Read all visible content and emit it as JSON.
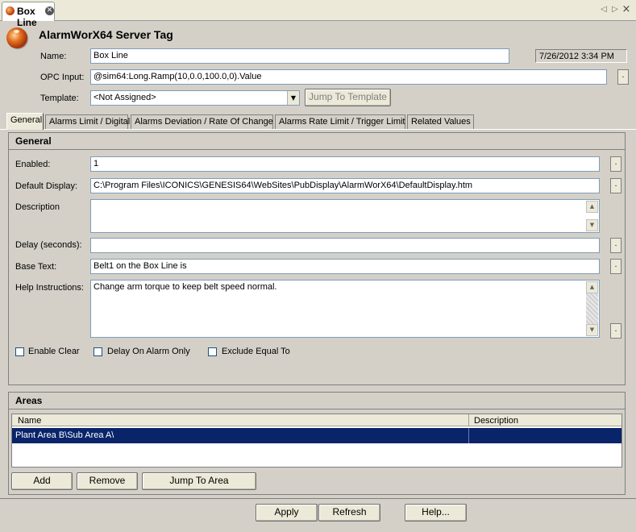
{
  "doc_tab": {
    "label": "Box Line",
    "close_glyph": "✕"
  },
  "nav": {
    "left": "◁",
    "right": "▷",
    "close": "×"
  },
  "header": {
    "title": "AlarmWorX64 Server Tag",
    "name_label": "Name:",
    "name_value": "Box Line",
    "timestamp": "7/26/2012 3:34 PM",
    "opc_label": "OPC Input:",
    "opc_value": "@sim64:Long.Ramp(10,0.0,100.0,0).Value",
    "template_label": "Template:",
    "template_value": "<Not Assigned>",
    "jump_template": "Jump To Template"
  },
  "tabs": [
    {
      "label": "General",
      "active": true
    },
    {
      "label": "Alarms Limit / Digital"
    },
    {
      "label": "Alarms Deviation / Rate Of Change"
    },
    {
      "label": "Alarms Rate Limit  / Trigger Limit"
    },
    {
      "label": "Related Values"
    }
  ],
  "general": {
    "section_title": "General",
    "enabled_label": "Enabled:",
    "enabled_value": "1",
    "default_display_label": "Default Display:",
    "default_display_value": "C:\\Program Files\\ICONICS\\GENESIS64\\WebSites\\PubDisplay\\AlarmWorX64\\DefaultDisplay.htm",
    "description_label": "Description",
    "description_value": "",
    "delay_label": "Delay (seconds):",
    "delay_value": "",
    "base_text_label": "Base Text:",
    "base_text_value": "Belt1 on the Box Line is",
    "help_label": "Help Instructions:",
    "help_value": "Change arm torque to keep belt speed normal.",
    "enable_clear": "Enable Clear",
    "delay_on_alarm_only": "Delay On Alarm Only",
    "exclude_equal_to": "Exclude Equal To"
  },
  "areas": {
    "section_title": "Areas",
    "col_name": "Name",
    "col_description": "Description",
    "rows": [
      {
        "name": "Plant Area B\\Sub Area A\\",
        "description": ""
      }
    ],
    "add": "Add",
    "remove": "Remove",
    "jump_to_area": "Jump To Area"
  },
  "footer": {
    "apply": "Apply",
    "refresh": "Refresh",
    "help": "Help..."
  },
  "icons": {
    "dots": ".",
    "scroll_up": "▲",
    "scroll_down": "▼",
    "combo_down": "▼"
  }
}
